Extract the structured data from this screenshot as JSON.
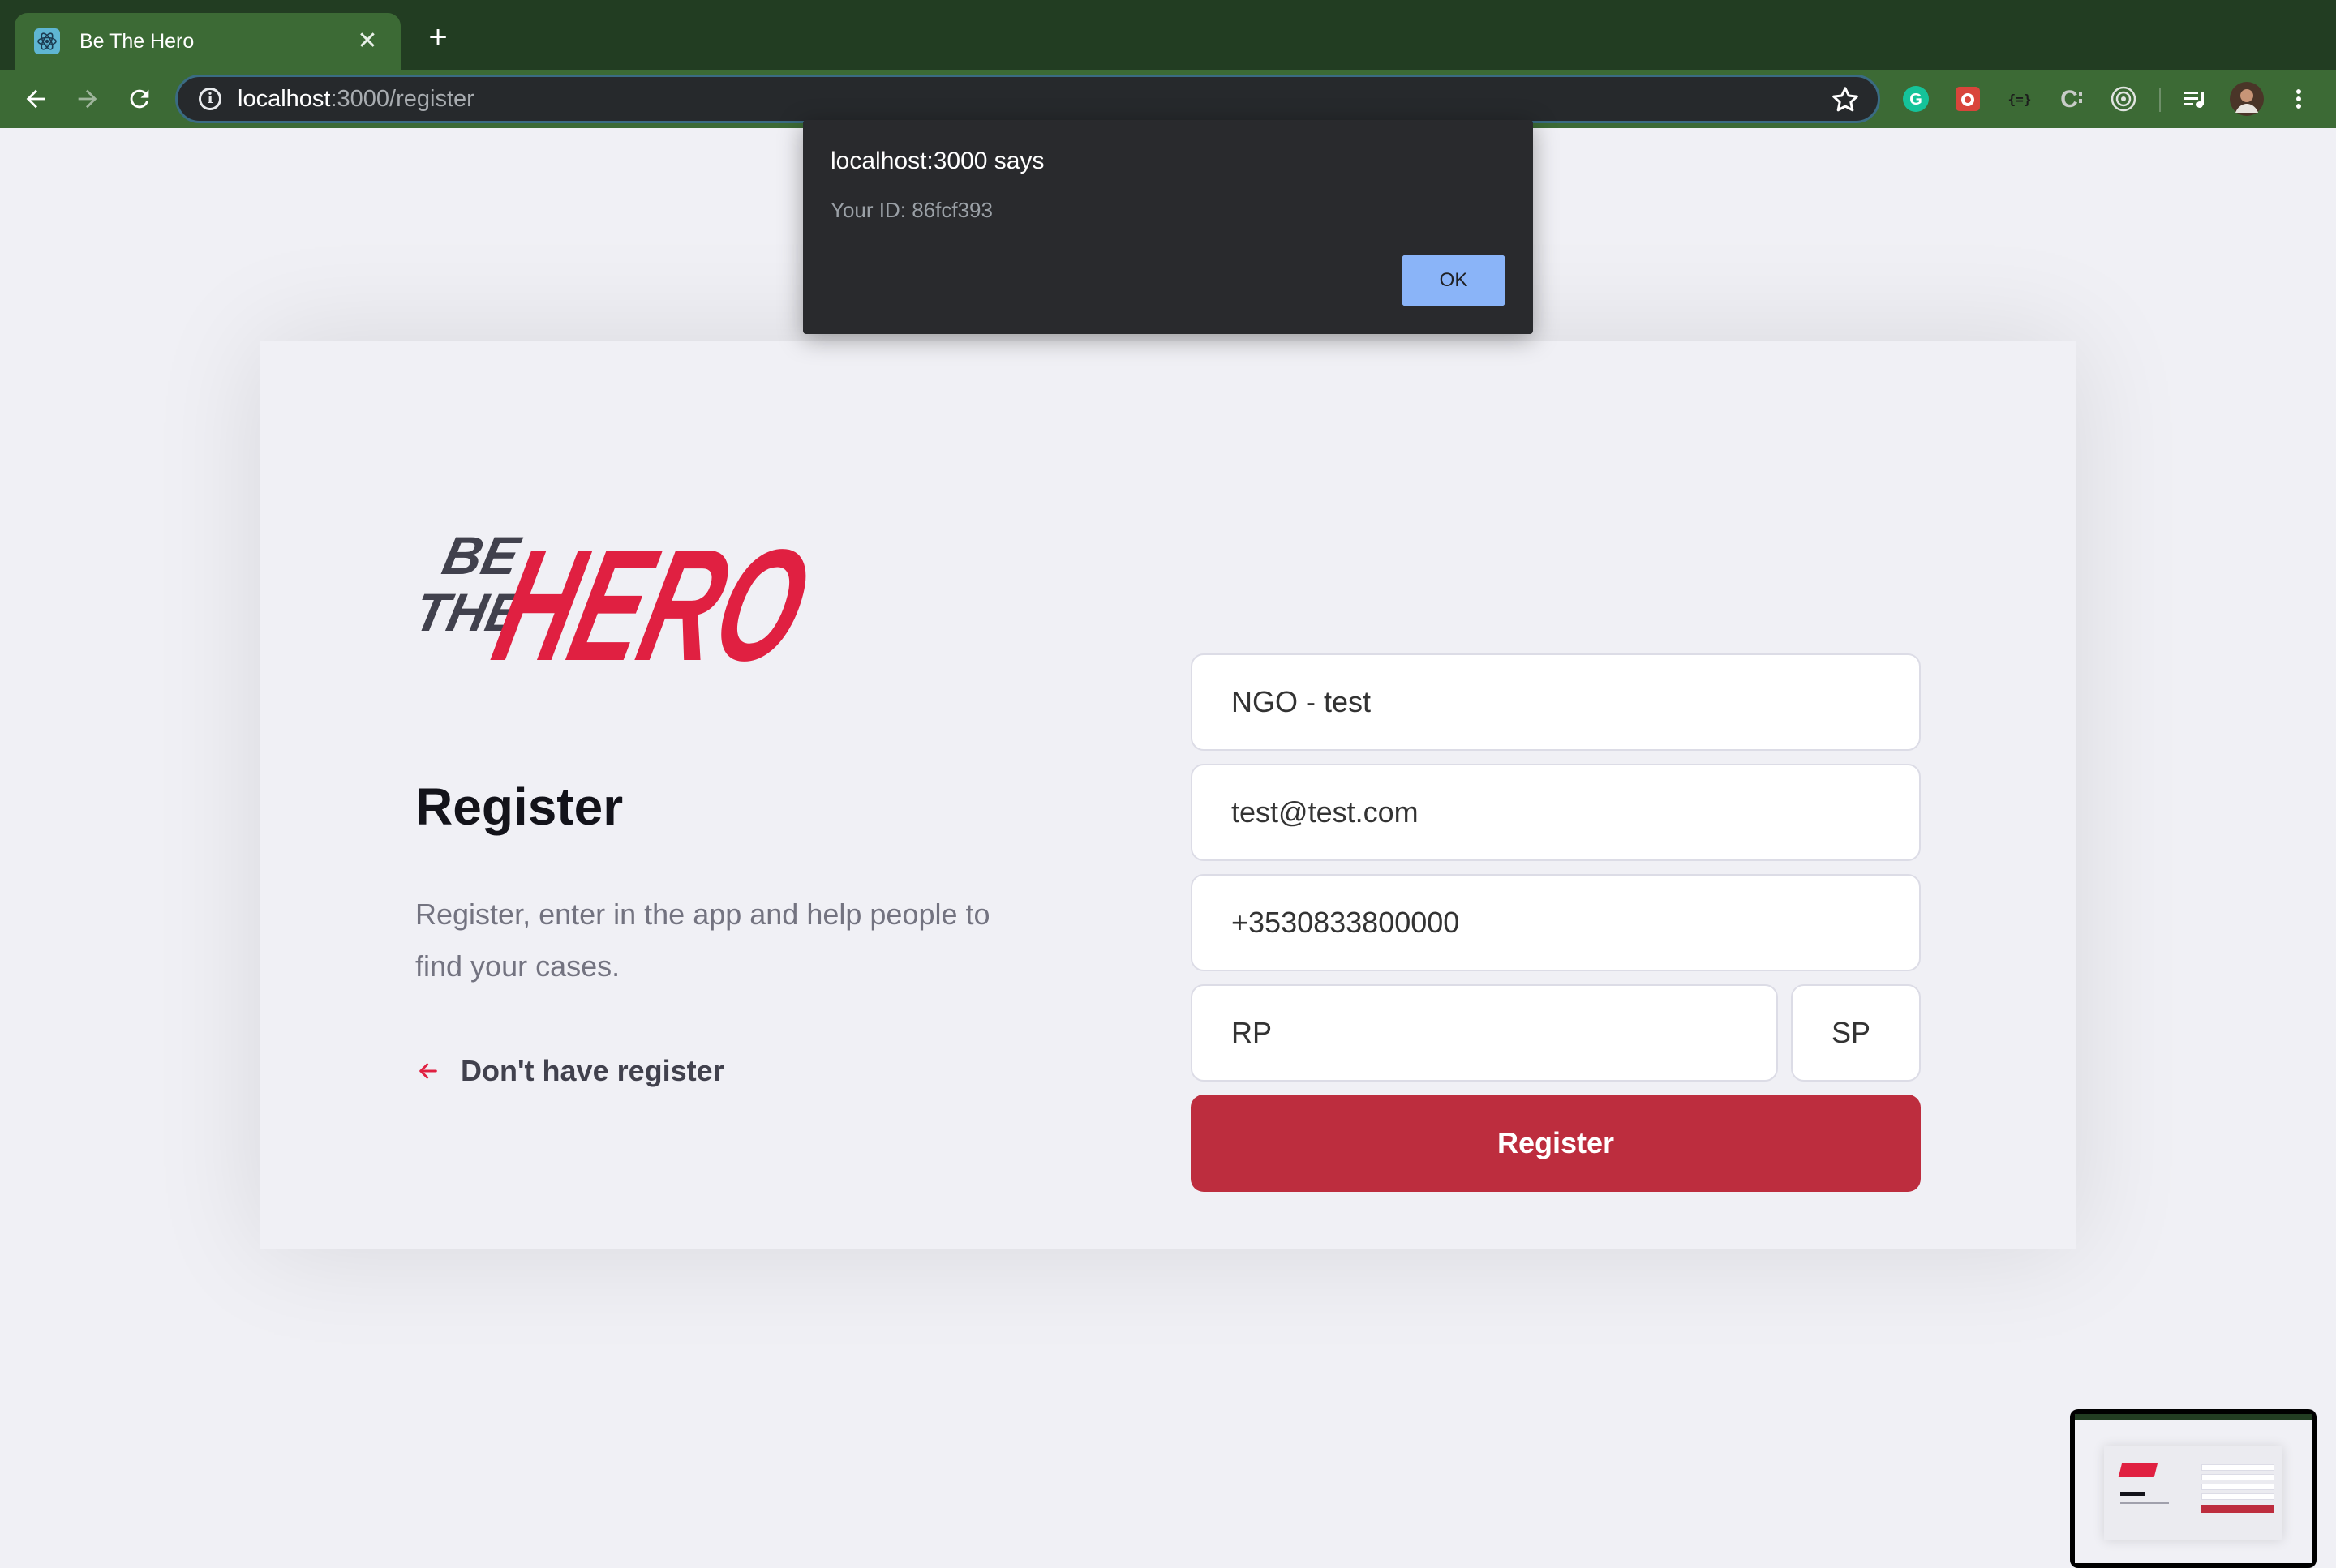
{
  "browser": {
    "tab": {
      "title": "Be The Hero",
      "close_label": "✕"
    },
    "new_tab_label": "+",
    "url_host": "localhost",
    "url_path": ":3000/register"
  },
  "alert": {
    "title": "localhost:3000 says",
    "message": "Your ID: 86fcf393",
    "ok_label": "OK"
  },
  "page": {
    "logo_text": {
      "be": "BE",
      "the": "THE",
      "hero": "HERO"
    },
    "title": "Register",
    "description": "Register, enter in the app and help people to find your cases.",
    "back_link": "Don't have register",
    "fields": {
      "name": "NGO - test",
      "email": "test@test.com",
      "whatsapp": "+3530833800000",
      "city": "RP",
      "uf": "SP"
    },
    "submit_label": "Register"
  },
  "colors": {
    "accent": "#bd2d3e",
    "logo_red": "#e02041",
    "background": "#f0f0f5",
    "browser_frame": "#223d22",
    "browser_toolbar": "#3c6a35",
    "dialog_bg": "#292a2d",
    "dialog_button": "#8ab4f8"
  },
  "icons": {
    "favicon": "react-icon",
    "back": "arrow-left-icon",
    "forward": "arrow-right-icon",
    "reload": "reload-icon",
    "site_info": "info-icon",
    "bookmark": "star-icon",
    "extensions": [
      "grammarly-icon",
      "extension-red-icon",
      "extension-code-icon",
      "extension-c-icon",
      "extension-target-icon",
      "media-queue-icon",
      "profile-avatar",
      "menu-dots-icon"
    ]
  }
}
